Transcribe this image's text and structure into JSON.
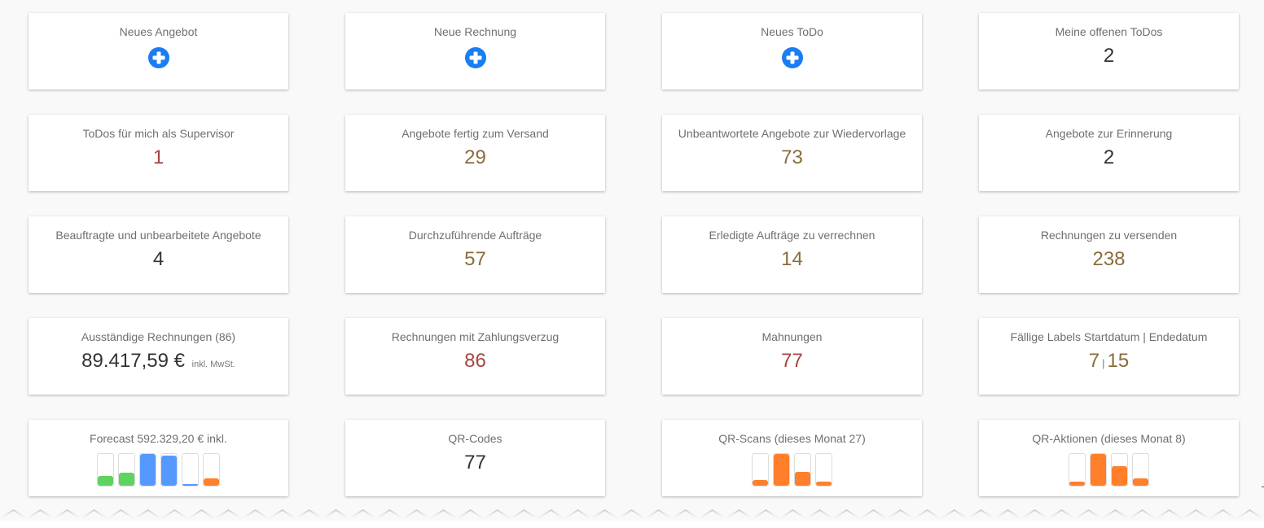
{
  "colors": {
    "accent_blue": "#1a7df2",
    "value_red": "#a94442",
    "value_gold": "#8a6d3b",
    "value_dark": "#333333",
    "bar_green": "#5fd35f",
    "bar_blue": "#5599ff",
    "bar_orange": "#ff7f2a"
  },
  "cards": [
    {
      "title": "Neues Angebot",
      "type": "action",
      "icon": "plus-circle-icon"
    },
    {
      "title": "Neue Rechnung",
      "type": "action",
      "icon": "plus-circle-icon"
    },
    {
      "title": "Neues ToDo",
      "type": "action",
      "icon": "plus-circle-icon"
    },
    {
      "title": "Meine offenen ToDos",
      "type": "count",
      "value": "2",
      "tone": "dark"
    },
    {
      "title": "ToDos für mich als Supervisor",
      "type": "count",
      "value": "1",
      "tone": "red"
    },
    {
      "title": "Angebote fertig zum Versand",
      "type": "count",
      "value": "29",
      "tone": "gold"
    },
    {
      "title": "Unbeantwortete Angebote zur Wiedervorlage",
      "type": "count",
      "value": "73",
      "tone": "gold"
    },
    {
      "title": "Angebote zur Erinnerung",
      "type": "count",
      "value": "2",
      "tone": "dark"
    },
    {
      "title": "Beauftragte und unbearbeitete Angebote",
      "type": "count",
      "value": "4",
      "tone": "dark"
    },
    {
      "title": "Durchzuführende Aufträge",
      "type": "count",
      "value": "57",
      "tone": "gold"
    },
    {
      "title": "Erledigte Aufträge zu verrechnen",
      "type": "count",
      "value": "14",
      "tone": "gold"
    },
    {
      "title": "Rechnungen zu versenden",
      "type": "count",
      "value": "238",
      "tone": "gold"
    },
    {
      "title": "Ausständige Rechnungen (86)",
      "type": "amount",
      "value": "89.417,59 €",
      "unit": "inkl. MwSt.",
      "tone": "dark"
    },
    {
      "title": "Rechnungen mit Zahlungsverzug",
      "type": "count",
      "value": "86",
      "tone": "red"
    },
    {
      "title": "Mahnungen",
      "type": "count",
      "value": "77",
      "tone": "red"
    },
    {
      "title": "Fällige Labels Startdatum | Endedatum",
      "type": "pair",
      "value_a": "7",
      "separator": "|",
      "value_b": "15",
      "tone": "gold"
    },
    {
      "title": "Forecast 592.329,20 € inkl.",
      "type": "bars",
      "bars": [
        {
          "fill": 0.32,
          "color": "green"
        },
        {
          "fill": 0.42,
          "color": "green"
        },
        {
          "fill": 1.0,
          "color": "blue"
        },
        {
          "fill": 0.95,
          "color": "blue"
        },
        {
          "fill": 0.06,
          "color": "blue"
        },
        {
          "fill": 0.22,
          "color": "orange"
        }
      ]
    },
    {
      "title": "QR-Codes",
      "type": "count",
      "value": "77",
      "tone": "dark"
    },
    {
      "title": "QR-Scans (dieses Monat 27)",
      "type": "bars",
      "bars": [
        {
          "fill": 0.18,
          "color": "orange"
        },
        {
          "fill": 1.0,
          "color": "orange"
        },
        {
          "fill": 0.44,
          "color": "orange"
        },
        {
          "fill": 0.13,
          "color": "orange"
        }
      ]
    },
    {
      "title": "QR-Aktionen (dieses Monat 8)",
      "type": "bars",
      "bars": [
        {
          "fill": 0.14,
          "color": "orange"
        },
        {
          "fill": 1.0,
          "color": "orange"
        },
        {
          "fill": 0.62,
          "color": "orange"
        },
        {
          "fill": 0.22,
          "color": "orange"
        }
      ]
    }
  ]
}
